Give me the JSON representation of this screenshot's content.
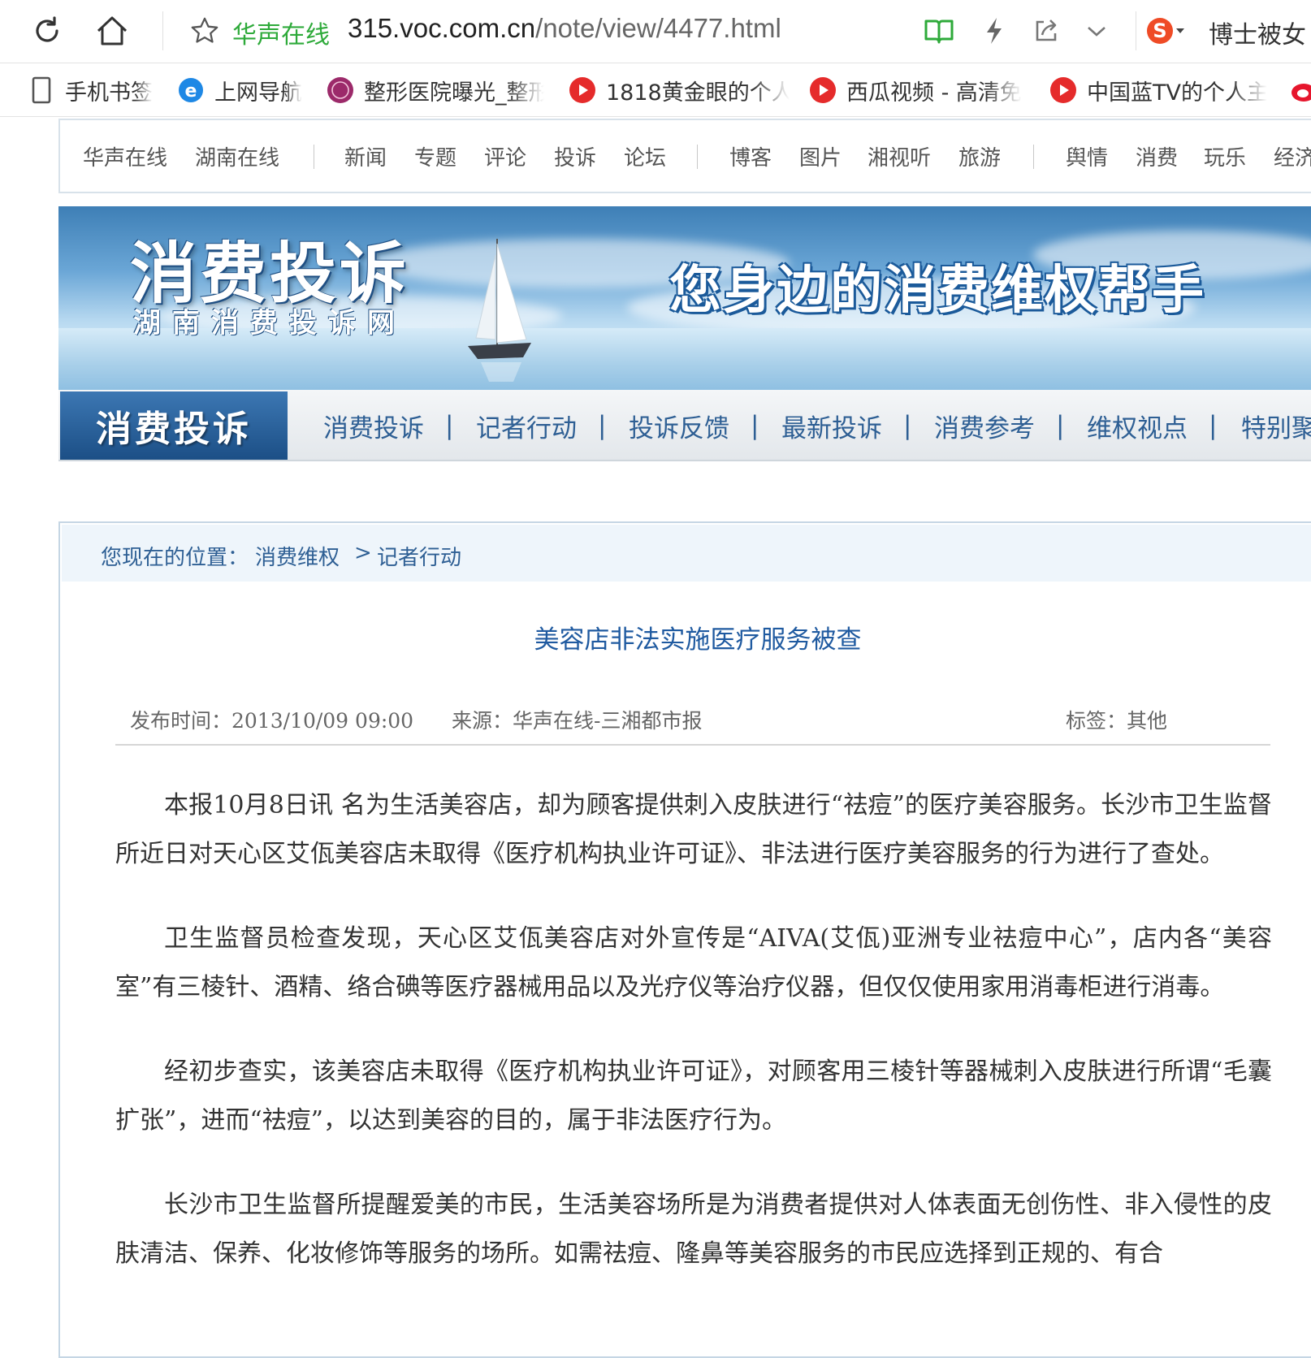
{
  "browser": {
    "site_name": "华声在线",
    "url_host": "315.voc.com.cn",
    "url_path": "/note/view/4477.html",
    "search_hint": "博士被女",
    "accent": "#2eaa3a"
  },
  "bookmarks": [
    {
      "label": "手机书签",
      "icon": "phone-icon"
    },
    {
      "label": "上网导航",
      "icon": "ie-icon"
    },
    {
      "label": "整形医院曝光_整形",
      "icon": "clinic-logo-icon"
    },
    {
      "label": "1818黄金眼的个人",
      "icon": "video-play-icon"
    },
    {
      "label": "西瓜视频 - 高清免",
      "icon": "video-play-icon"
    },
    {
      "label": "中国蓝TV的个人主",
      "icon": "video-play-icon"
    }
  ],
  "topnav": {
    "group1": [
      "华声在线",
      "湖南在线"
    ],
    "group2": [
      "新闻",
      "专题",
      "评论",
      "投诉",
      "论坛"
    ],
    "group3": [
      "博客",
      "图片",
      "湘视听",
      "旅游"
    ],
    "group4": [
      "舆情",
      "消费",
      "玩乐",
      "经济"
    ]
  },
  "banner": {
    "title": "消费投诉",
    "subtitle": "湖南消费投诉网",
    "slogan": "您身边的消费维权帮手"
  },
  "secnav": {
    "brand": "消费投诉",
    "items": [
      "消费投诉",
      "记者行动",
      "投诉反馈",
      "最新投诉",
      "消费参考",
      "维权视点",
      "特别聚"
    ]
  },
  "breadcrumb": {
    "prefix": "您现在的位置：",
    "level1": "消费维权",
    "separator": ">",
    "level2": "记者行动"
  },
  "article": {
    "title": "美容店非法实施医疗服务被查",
    "published": "发布时间：2013/10/09 09:00",
    "source": "来源：华声在线-三湘都市报",
    "tags": "标签：其他",
    "paragraphs": [
      "本报10月8日讯 名为生活美容店，却为顾客提供刺入皮肤进行“祛痘”的医疗美容服务。长沙市卫生监督所近日对天心区艾佤美容店未取得《医疗机构执业许可证》、非法进行医疗美容服务的行为进行了查处。",
      "卫生监督员检查发现，天心区艾佤美容店对外宣传是“AIVA(艾佤)亚洲专业祛痘中心”，店内各“美容室”有三棱针、酒精、络合碘等医疗器械用品以及光疗仪等治疗仪器，但仅仅使用家用消毒柜进行消毒。",
      "经初步查实，该美容店未取得《医疗机构执业许可证》，对顾客用三棱针等器械刺入皮肤进行所谓“毛囊扩张”，进而“祛痘”，以达到美容的目的，属于非法医疗行为。",
      "长沙市卫生监督所提醒爱美的市民，生活美容场所是为消费者提供对人体表面无创伤性、非入侵性的皮肤清洁、保养、化妆修饰等服务的场所。如需祛痘、隆鼻等美容服务的市民应选择到正规的、有合"
    ]
  }
}
